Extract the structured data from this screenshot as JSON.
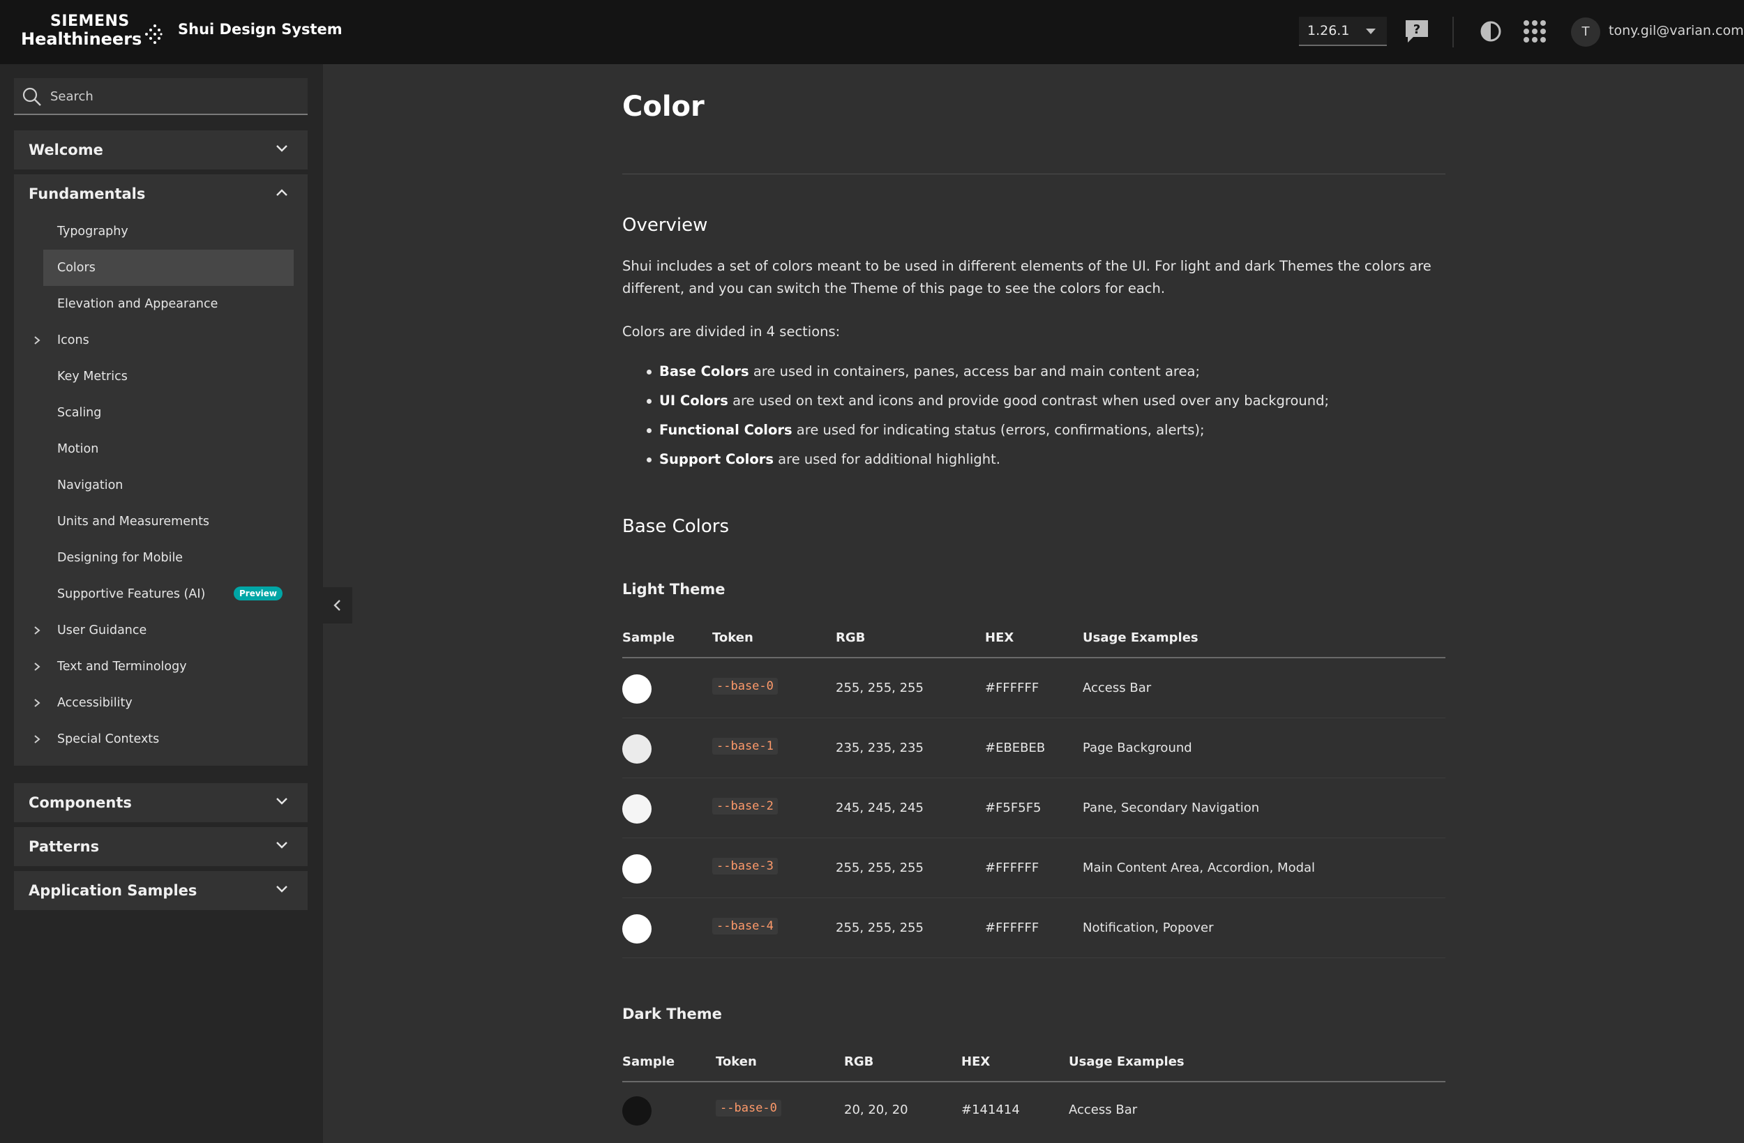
{
  "header": {
    "brand_line1": "SIEMENS",
    "brand_line2": "Healthineers",
    "app_title": "Shui Design System",
    "version": "1.26.1",
    "avatar_initial": "T",
    "user_email": "tony.gil@varian.com",
    "icons": [
      "help-chat-icon",
      "theme-contrast-icon",
      "app-grid-icon"
    ]
  },
  "sidebar": {
    "search_placeholder": "Search",
    "sections": {
      "welcome": "Welcome",
      "fundamentals": "Fundamentals",
      "components": "Components",
      "patterns": "Patterns",
      "application_samples": "Application Samples"
    },
    "fundamentals_items": [
      {
        "label": "Typography"
      },
      {
        "label": "Colors",
        "active": true
      },
      {
        "label": "Elevation and Appearance"
      },
      {
        "label": "Icons",
        "expandable": true
      },
      {
        "label": "Key Metrics"
      },
      {
        "label": "Scaling"
      },
      {
        "label": "Motion"
      },
      {
        "label": "Navigation"
      },
      {
        "label": "Units and Measurements"
      },
      {
        "label": "Designing for Mobile"
      },
      {
        "label": "Supportive Features (AI)",
        "badge": "Preview"
      },
      {
        "label": "User Guidance",
        "expandable": true
      },
      {
        "label": "Text and Terminology",
        "expandable": true
      },
      {
        "label": "Accessibility",
        "expandable": true
      },
      {
        "label": "Special Contexts",
        "expandable": true
      }
    ]
  },
  "main": {
    "title": "Color",
    "overview_heading": "Overview",
    "overview_text": "Shui includes a set of colors meant to be used in different elements of the UI. For light and dark Themes the colors are different, and you can switch the Theme of this page to see the colors for each.",
    "sections_intro": "Colors are divided in 4 sections:",
    "bullets": [
      {
        "bold": "Base Colors",
        "text": " are used in containers, panes, access bar and main content area;"
      },
      {
        "bold": "UI Colors",
        "text": " are used on text and icons and provide good contrast when used over any background;"
      },
      {
        "bold": "Functional Colors",
        "text": " are used for indicating status (errors, confirmations, alerts);"
      },
      {
        "bold": "Support Colors",
        "text": " are used for additional highlight."
      }
    ],
    "base_colors_heading": "Base Colors",
    "table_headers": {
      "sample": "Sample",
      "token": "Token",
      "rgb": "RGB",
      "hex": "HEX",
      "usage": "Usage Examples"
    },
    "light_theme": {
      "heading": "Light Theme",
      "rows": [
        {
          "swatch": "#FFFFFF",
          "token": "--base-0",
          "rgb": "255, 255, 255",
          "hex": "#FFFFFF",
          "usage": "Access Bar"
        },
        {
          "swatch": "#EBEBEB",
          "token": "--base-1",
          "rgb": "235, 235, 235",
          "hex": "#EBEBEB",
          "usage": "Page Background"
        },
        {
          "swatch": "#F5F5F5",
          "token": "--base-2",
          "rgb": "245, 245, 245",
          "hex": "#F5F5F5",
          "usage": "Pane, Secondary Navigation"
        },
        {
          "swatch": "#FFFFFF",
          "token": "--base-3",
          "rgb": "255, 255, 255",
          "hex": "#FFFFFF",
          "usage": "Main Content Area, Accordion, Modal"
        },
        {
          "swatch": "#FFFFFF",
          "token": "--base-4",
          "rgb": "255, 255, 255",
          "hex": "#FFFFFF",
          "usage": "Notification, Popover"
        }
      ]
    },
    "dark_theme": {
      "heading": "Dark Theme",
      "rows": [
        {
          "swatch": "#141414",
          "token": "--base-0",
          "rgb": "20, 20, 20",
          "hex": "#141414",
          "usage": "Access Bar"
        }
      ]
    }
  }
}
